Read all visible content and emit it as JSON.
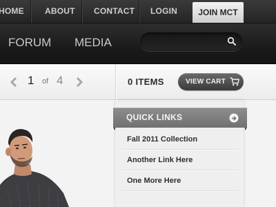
{
  "topnav": {
    "items": [
      "HOME",
      "ABOUT",
      "CONTACT",
      "LOGIN"
    ],
    "join_label": "JOIN MCT"
  },
  "mainnav": {
    "items": [
      "FORUM",
      "MEDIA"
    ]
  },
  "search": {
    "placeholder": "",
    "icon": "magnifier-icon"
  },
  "pagination": {
    "current": "1",
    "of_label": "of",
    "total": "4"
  },
  "cart": {
    "count_label": "0 ITEMS",
    "button_label": "VIEW CART",
    "icon": "cart-icon"
  },
  "quicklinks": {
    "title": "QUICK LINKS",
    "links": [
      "Fall 2011 Collection",
      "Another Link Here",
      "One More Here"
    ]
  },
  "colors": {
    "topbar": "#2f2f2f",
    "header": "#1c1c1c",
    "accent_gray": "#7e7e7e",
    "page_bg": "#f3f3f3"
  }
}
